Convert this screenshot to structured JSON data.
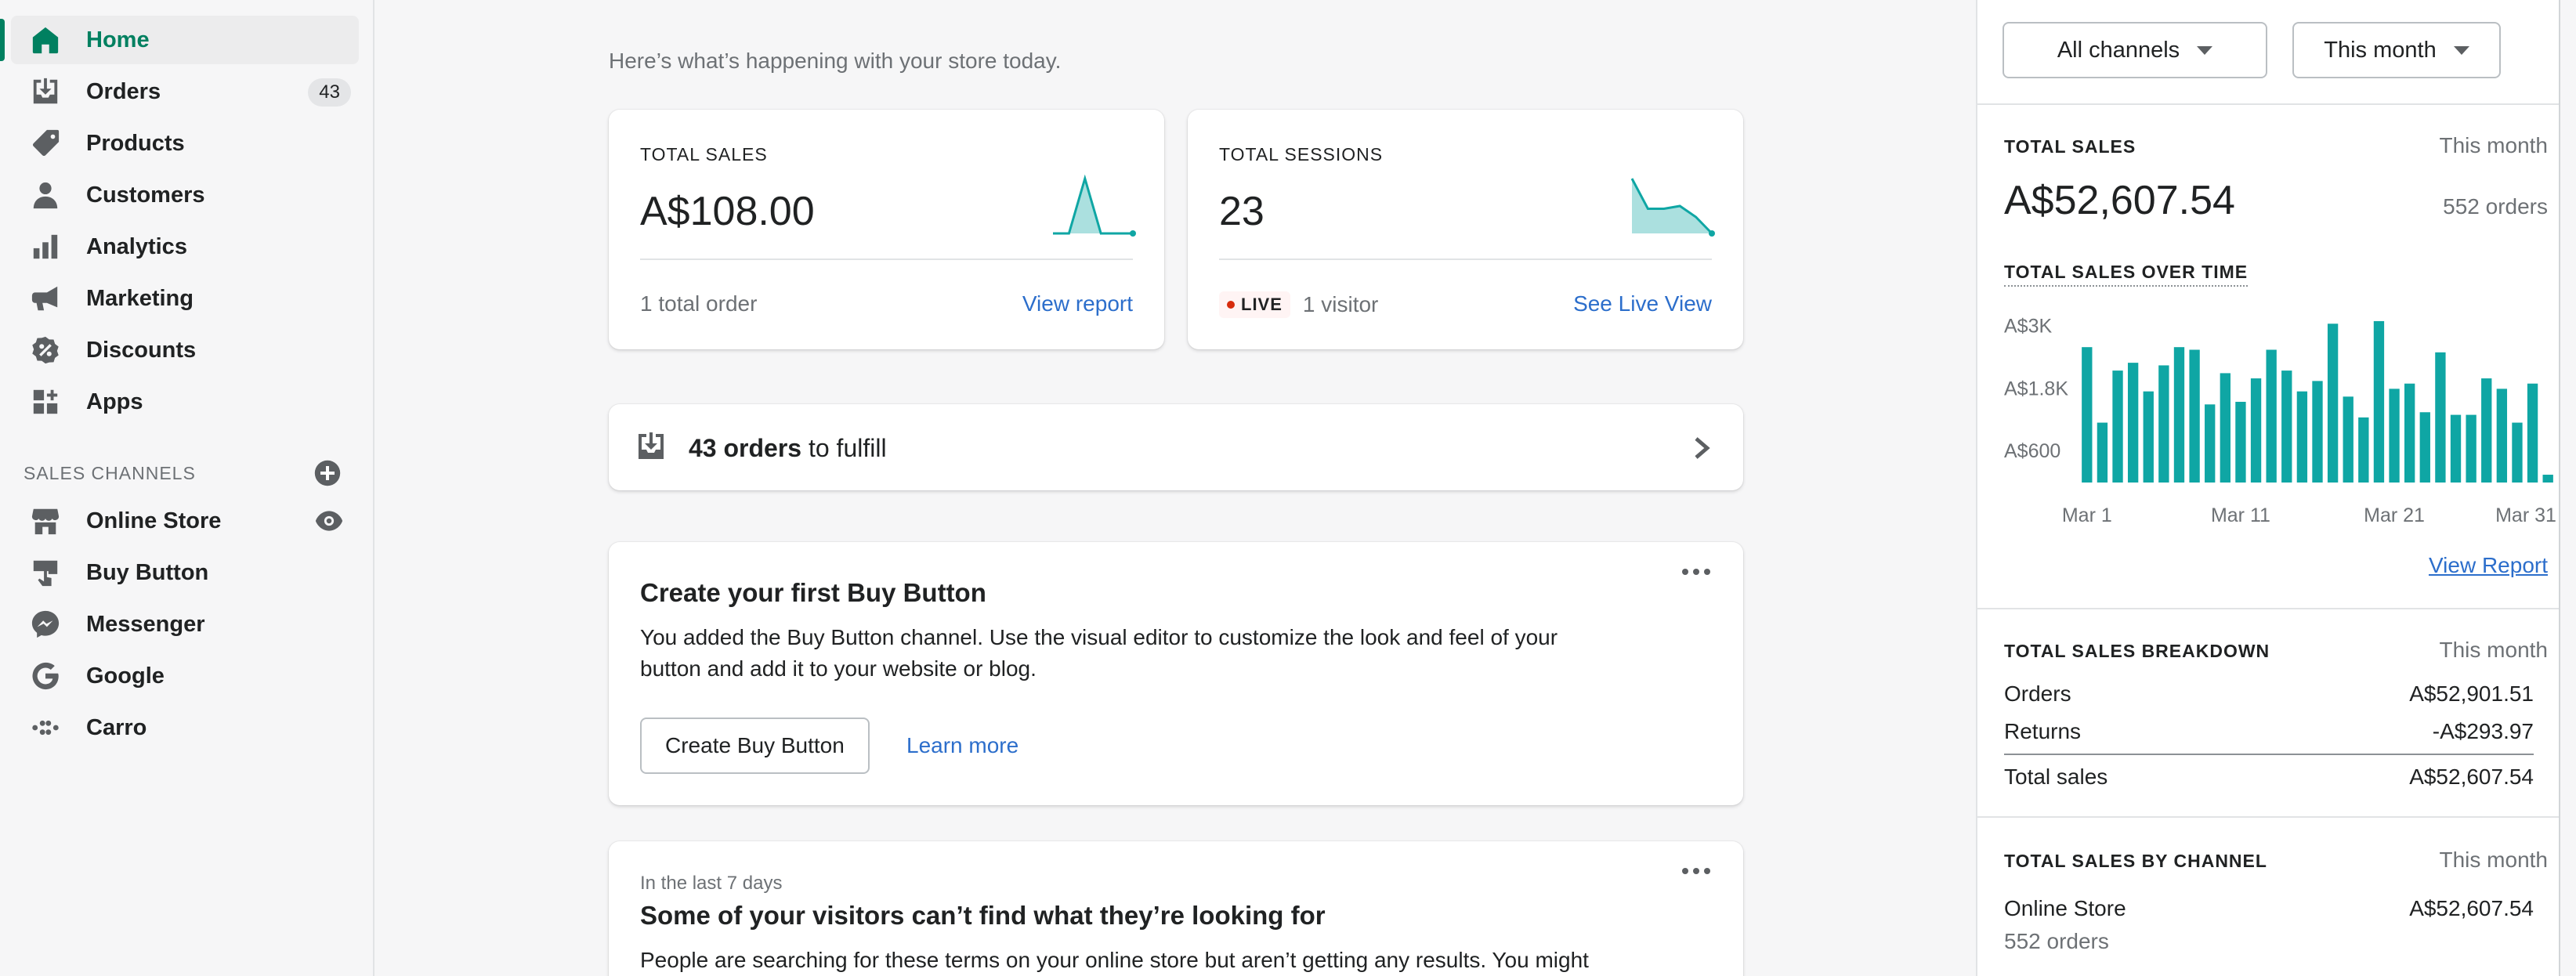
{
  "sidebar": {
    "items": [
      {
        "label": "Home",
        "icon": "home-icon",
        "active": true
      },
      {
        "label": "Orders",
        "icon": "orders-icon",
        "badge": "43"
      },
      {
        "label": "Products",
        "icon": "tag-icon"
      },
      {
        "label": "Customers",
        "icon": "person-icon"
      },
      {
        "label": "Analytics",
        "icon": "bar-chart-icon"
      },
      {
        "label": "Marketing",
        "icon": "megaphone-icon"
      },
      {
        "label": "Discounts",
        "icon": "discount-icon"
      },
      {
        "label": "Apps",
        "icon": "apps-icon"
      }
    ],
    "section_title": "SALES CHANNELS",
    "channels": [
      {
        "label": "Online Store",
        "icon": "store-icon"
      },
      {
        "label": "Buy Button",
        "icon": "buy-button-icon"
      },
      {
        "label": "Messenger",
        "icon": "messenger-icon"
      },
      {
        "label": "Google",
        "icon": "google-icon"
      },
      {
        "label": "Carro",
        "icon": "carro-icon"
      }
    ]
  },
  "main": {
    "greeting": "Here’s what’s happening with your store today.",
    "total_sales": {
      "label": "TOTAL SALES",
      "value": "A$108.00",
      "footer": "1 total order",
      "link": "View report"
    },
    "total_sessions": {
      "label": "TOTAL SESSIONS",
      "value": "23",
      "live": "LIVE",
      "footer": "1 visitor",
      "link": "See Live View"
    },
    "fulfill": {
      "count": "43 orders",
      "rest": " to fulfill"
    },
    "buy_button_card": {
      "title": "Create your first Buy Button",
      "body": "You added the Buy Button channel. Use the visual editor to customize the look and feel of your button and add it to your website or blog.",
      "primary": "Create Buy Button",
      "secondary": "Learn more"
    },
    "search_card": {
      "caption": "In the last 7 days",
      "title": "Some of your visitors can’t find what they’re looking for",
      "body": "People are searching for these terms on your online store but aren’t getting any results. You might"
    }
  },
  "right_panel": {
    "channels_dropdown": "All channels",
    "period_dropdown": "This month",
    "total_sales": {
      "label": "TOTAL SALES",
      "period": "This month",
      "value": "A$52,607.54",
      "orders": "552 orders"
    },
    "over_time_label": "TOTAL SALES OVER TIME",
    "view_report": "View Report",
    "breakdown": {
      "label": "TOTAL SALES BREAKDOWN",
      "period": "This month",
      "rows": [
        {
          "name": "Orders",
          "value": "A$52,901.51"
        },
        {
          "name": "Returns",
          "value": "-A$293.97"
        },
        {
          "name": "Total sales",
          "value": "A$52,607.54"
        }
      ]
    },
    "by_channel": {
      "label": "TOTAL SALES BY CHANNEL",
      "period": "This month",
      "channel": "Online Store",
      "value": "A$52,607.54",
      "orders": "552 orders"
    }
  },
  "chart_data": {
    "type": "bar",
    "y_tick_labels": [
      "A$3K",
      "A$1.8K",
      "A$600"
    ],
    "y_ticks": [
      3000,
      1800,
      600
    ],
    "ylim": [
      0,
      3400
    ],
    "x_tick_labels": [
      "Mar 1",
      "Mar 11",
      "Mar 21",
      "Mar 31"
    ],
    "categories": [
      "Mar 1",
      "Mar 2",
      "Mar 3",
      "Mar 4",
      "Mar 5",
      "Mar 6",
      "Mar 7",
      "Mar 8",
      "Mar 9",
      "Mar 10",
      "Mar 11",
      "Mar 12",
      "Mar 13",
      "Mar 14",
      "Mar 15",
      "Mar 16",
      "Mar 17",
      "Mar 18",
      "Mar 19",
      "Mar 20",
      "Mar 21",
      "Mar 22",
      "Mar 23",
      "Mar 24",
      "Mar 25",
      "Mar 26",
      "Mar 27",
      "Mar 28",
      "Mar 29",
      "Mar 30",
      "Mar 31"
    ],
    "values": [
      2600,
      1150,
      2150,
      2300,
      1750,
      2250,
      2600,
      2550,
      1500,
      2100,
      1550,
      2000,
      2550,
      2150,
      1750,
      1950,
      3050,
      1650,
      1250,
      3100,
      1800,
      1900,
      1350,
      2500,
      1300,
      1300,
      2000,
      1800,
      1150,
      1900,
      150
    ],
    "colors": {
      "bar": "#0fa6a4"
    }
  },
  "sparklines": {
    "sales": [
      0,
      0,
      1,
      0,
      0,
      0
    ],
    "sessions": [
      1,
      0.45,
      0.45,
      0.5,
      0.3,
      0
    ]
  },
  "colors": {
    "accent": "#008060",
    "link": "#2c6ecb",
    "teal": "#0fa6a4",
    "live_dot": "#d72c0d"
  }
}
